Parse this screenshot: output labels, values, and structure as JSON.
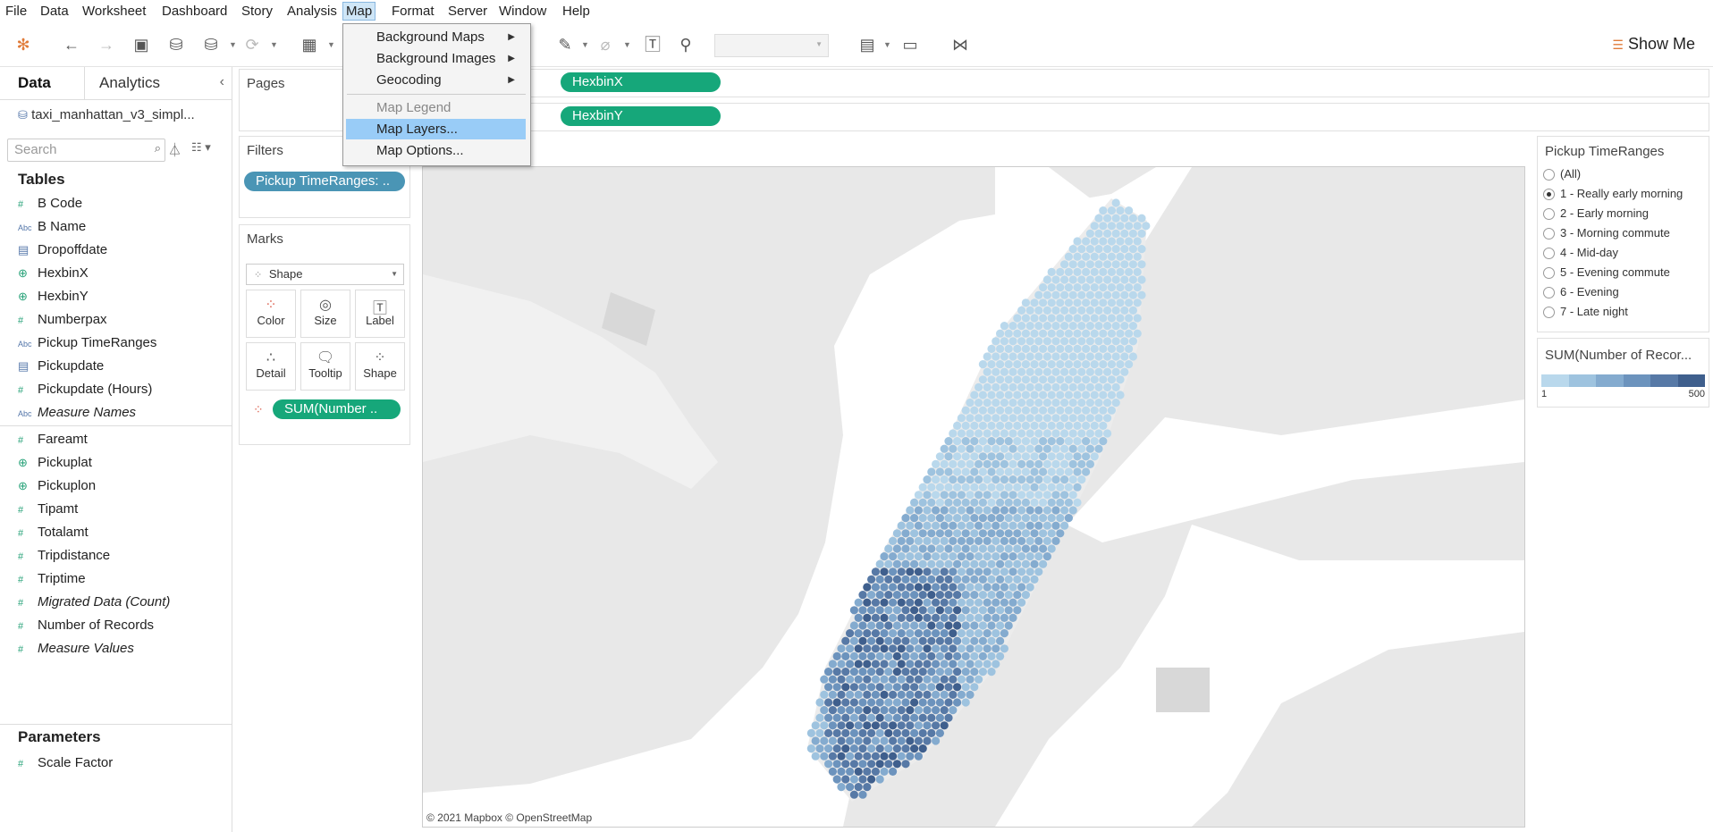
{
  "menubar": [
    "File",
    "Data",
    "Worksheet",
    "Dashboard",
    "Story",
    "Analysis",
    "Map",
    "Format",
    "Server",
    "Window",
    "Help"
  ],
  "toolbar": {
    "show_me": "Show Me"
  },
  "leftpane": {
    "tab_data": "Data",
    "tab_analytics": "Analytics",
    "datasource": "taxi_manhattan_v3_simpl...",
    "search_placeholder": "Search",
    "tables_heading": "Tables",
    "dimensions": [
      {
        "type": "num",
        "label": "B Code"
      },
      {
        "type": "abc",
        "label": "B Name"
      },
      {
        "type": "cal",
        "label": "Dropoffdate"
      },
      {
        "type": "geo",
        "label": "HexbinX"
      },
      {
        "type": "geo",
        "label": "HexbinY"
      },
      {
        "type": "num",
        "label": "Numberpax"
      },
      {
        "type": "abc",
        "label": "Pickup TimeRanges"
      },
      {
        "type": "cal",
        "label": "Pickupdate"
      },
      {
        "type": "num",
        "label": "Pickupdate (Hours)"
      },
      {
        "type": "abc",
        "label": "Measure Names"
      }
    ],
    "measures": [
      {
        "type": "num",
        "label": "Fareamt"
      },
      {
        "type": "geo",
        "label": "Pickuplat"
      },
      {
        "type": "geo",
        "label": "Pickuplon"
      },
      {
        "type": "num",
        "label": "Tipamt"
      },
      {
        "type": "num",
        "label": "Totalamt"
      },
      {
        "type": "num",
        "label": "Tripdistance"
      },
      {
        "type": "num",
        "label": "Triptime"
      },
      {
        "type": "num",
        "label": "Migrated Data (Count)"
      },
      {
        "type": "num",
        "label": "Number of Records"
      },
      {
        "type": "num",
        "label": "Measure Values"
      }
    ],
    "parameters_heading": "Parameters",
    "parameters": [
      {
        "type": "num",
        "label": "Scale Factor"
      }
    ]
  },
  "cards": {
    "pages_title": "Pages",
    "columns_pill": "HexbinX",
    "rows_pill": "HexbinY",
    "filters_title": "Filters",
    "filter_pill": "Pickup TimeRanges: ..",
    "marks_title": "Marks",
    "mark_type": "Shape",
    "mark_buttons": [
      "Color",
      "Size",
      "Label",
      "Detail",
      "Tooltip",
      "Shape"
    ],
    "color_pill": "SUM(Number .."
  },
  "map": {
    "attribution": "© 2021 Mapbox © OpenStreetMap"
  },
  "legend_filter": {
    "title": "Pickup TimeRanges",
    "options": [
      "(All)",
      "1 - Really early morning",
      "2 - Early morning",
      "3 - Morning commute",
      "4 - Mid-day",
      "5 - Evening commute",
      "6 - Evening",
      "7 - Late night"
    ],
    "selected_index": 1
  },
  "legend_color": {
    "title": "SUM(Number of Recor...",
    "min_label": "1",
    "max_label": "500",
    "ramp_colors": [
      "#b9d8ec",
      "#9ec3df",
      "#84abcf",
      "#6c93bd",
      "#5779a6",
      "#3f5f8d"
    ]
  },
  "map_menu": {
    "items": [
      {
        "label": "Background Maps",
        "submenu": true,
        "disabled": false
      },
      {
        "label": "Background Images",
        "submenu": true,
        "disabled": false
      },
      {
        "label": "Geocoding",
        "submenu": true,
        "disabled": false
      },
      {
        "label": "Map Legend",
        "submenu": false,
        "disabled": true
      },
      {
        "label": "Map Layers...",
        "submenu": false,
        "disabled": false,
        "highlighted": true
      },
      {
        "label": "Map Options...",
        "submenu": false,
        "disabled": false
      }
    ]
  }
}
